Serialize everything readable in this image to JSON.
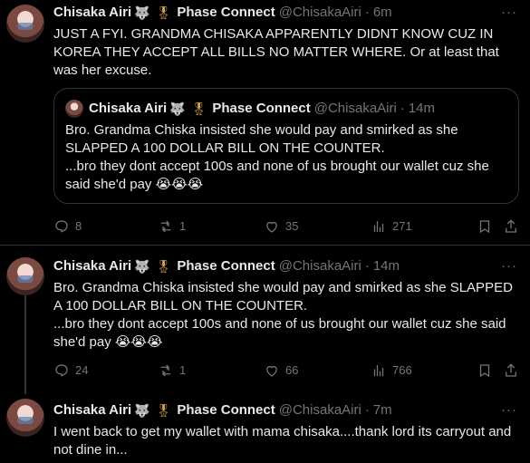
{
  "author": {
    "name": "Chisaka Airi",
    "badge_wolf": "🐺",
    "badge_medal": "🎖",
    "affiliation": "Phase Connect",
    "handle": "@ChisakaAiri"
  },
  "tweets": [
    {
      "time": "6m",
      "text": "JUST A FYI. GRANDMA CHISAKA APPARENTLY DIDNT KNOW CUZ IN KOREA THEY ACCEPT ALL BILLS NO MATTER WHERE. Or at least that was her excuse.",
      "quote": {
        "time": "14m",
        "text": "Bro. Grandma Chiska insisted she would pay and smirked as she SLAPPED A 100 DOLLAR BILL ON THE COUNTER.\n...bro they dont accept 100s and none of us brought our wallet cuz she said she'd pay 😭😭😭"
      },
      "replies": "8",
      "reposts": "1",
      "likes": "35",
      "views": "271"
    },
    {
      "time": "14m",
      "text": "Bro. Grandma Chiska insisted she would pay and smirked as she SLAPPED A 100 DOLLAR BILL ON THE COUNTER.\n...bro they dont accept 100s and none of us brought our wallet cuz she said she'd pay 😭😭😭",
      "replies": "24",
      "reposts": "1",
      "likes": "66",
      "views": "766"
    },
    {
      "time": "7m",
      "text": "I went back to get my wallet with mama chisaka....thank lord its carryout and not dine in..."
    }
  ],
  "more_label": "···"
}
